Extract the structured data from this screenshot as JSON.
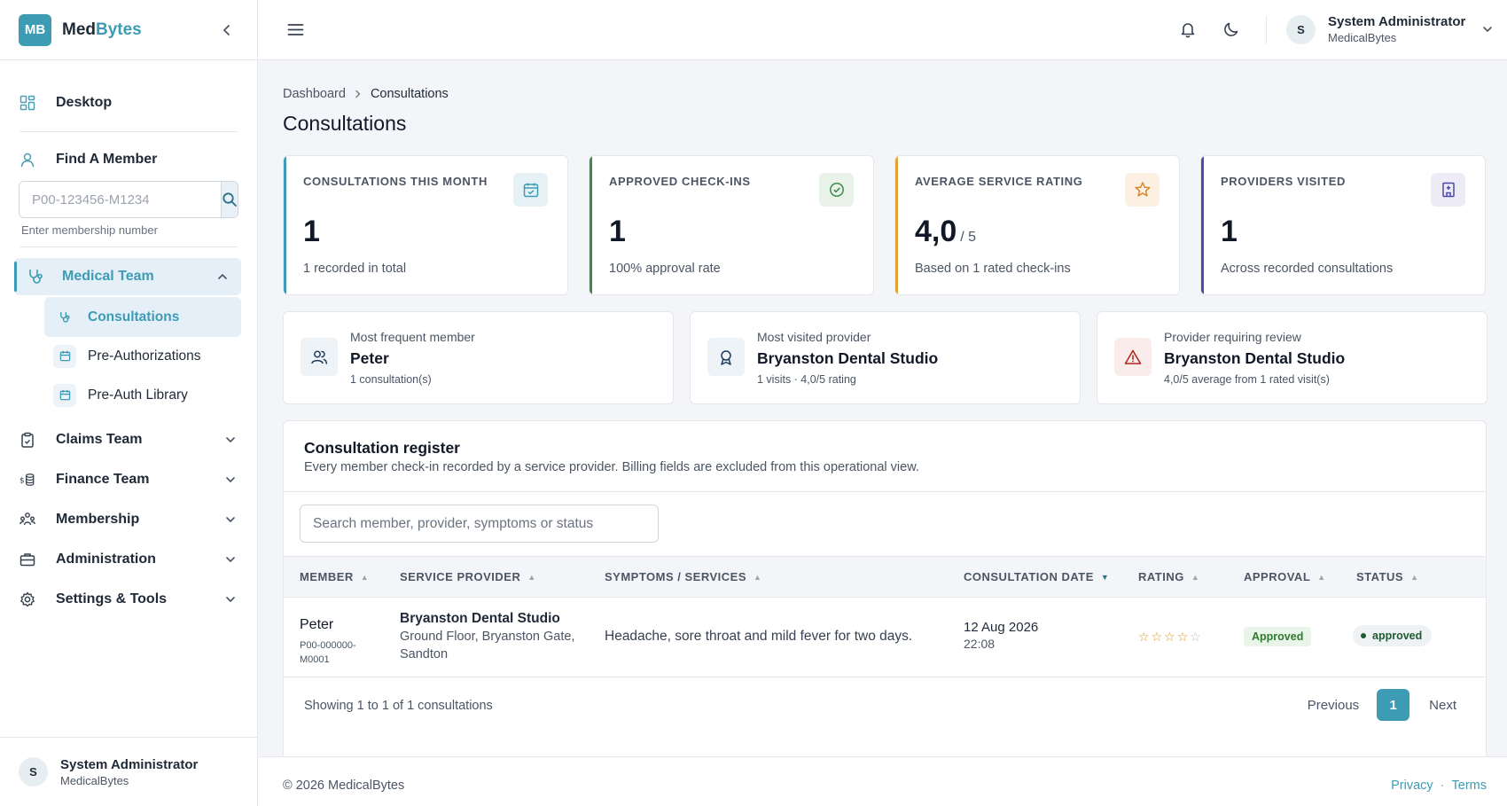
{
  "brand": {
    "badge": "MB",
    "name_a": "Med",
    "name_b": "Bytes",
    "accent_color": "#3d9bb4"
  },
  "sidebar": {
    "desktop_label": "Desktop",
    "find_member_label": "Find A Member",
    "member_search_placeholder": "P00-123456-M1234",
    "member_search_hint": "Enter membership number",
    "medical_team_label": "Medical Team",
    "medical_team_items": [
      {
        "label": "Consultations",
        "icon": "stethoscope-icon",
        "active": true
      },
      {
        "label": "Pre-Authorizations",
        "icon": "calendar-icon",
        "active": false
      },
      {
        "label": "Pre-Auth Library",
        "icon": "calendar-icon",
        "active": false
      }
    ],
    "groups": [
      {
        "label": "Claims Team",
        "icon": "clipboard-icon"
      },
      {
        "label": "Finance Team",
        "icon": "coins-icon"
      },
      {
        "label": "Membership",
        "icon": "users-icon"
      },
      {
        "label": "Administration",
        "icon": "briefcase-icon"
      },
      {
        "label": "Settings & Tools",
        "icon": "gear-icon"
      }
    ],
    "user": {
      "initial": "S",
      "name": "System Administrator",
      "org": "MedicalBytes"
    }
  },
  "topbar": {
    "user": {
      "initial": "S",
      "name": "System Administrator",
      "org": "MedicalBytes"
    }
  },
  "breadcrumb": {
    "root": "Dashboard",
    "current": "Consultations"
  },
  "page_title": "Consultations",
  "stats": [
    {
      "key": "CONSULTATIONS THIS MONTH",
      "value": "1",
      "suffix": "",
      "desc": "1 recorded in total",
      "color": "#3d9bb4",
      "icon": "calendar-check-icon"
    },
    {
      "key": "APPROVED CHECK-INS",
      "value": "1",
      "suffix": "",
      "desc": "100% approval rate",
      "color": "#3f8a4b",
      "icon": "check-circle-icon"
    },
    {
      "key": "AVERAGE SERVICE RATING",
      "value": "4,0",
      "suffix": "/ 5",
      "desc": "Based on 1 rated check-ins",
      "color": "#e0a33a",
      "icon": "star-icon"
    },
    {
      "key": "PROVIDERS VISITED",
      "value": "1",
      "suffix": "",
      "desc": "Across recorded consultations",
      "color": "#4b4aa6",
      "icon": "hospital-icon"
    }
  ],
  "insights": [
    {
      "title": "Most frequent member",
      "headline": "Peter",
      "sub": "1 consultation(s)",
      "icon": "users-icon"
    },
    {
      "title": "Most visited provider",
      "headline": "Bryanston Dental Studio",
      "sub": "1 visits · 4,0/5 rating",
      "icon": "award-icon"
    },
    {
      "title": "Provider requiring review",
      "headline": "Bryanston Dental Studio",
      "sub": "4,0/5 average from 1 rated visit(s)",
      "icon": "warning-icon"
    }
  ],
  "register": {
    "title": "Consultation register",
    "description": "Every member check-in recorded by a service provider. Billing fields are excluded from this operational view.",
    "search_placeholder": "Search member, provider, symptoms or status",
    "columns": [
      "MEMBER",
      "SERVICE PROVIDER",
      "SYMPTOMS / SERVICES",
      "CONSULTATION DATE",
      "RATING",
      "APPROVAL",
      "STATUS"
    ],
    "rows": [
      {
        "member": "Peter",
        "member_id": "P00-000000-M0001",
        "provider": "Bryanston Dental Studio",
        "provider_address": "Ground Floor, Bryanston Gate, Sandton",
        "symptoms": "Headache, sore throat and mild fever for two days.",
        "date": "12 Aug 2026",
        "time": "22:08",
        "rating": 4,
        "rating_max": 5,
        "approval": "Approved",
        "status": "approved"
      }
    ],
    "summary": "Showing 1 to 1 of 1 consultations",
    "pager": {
      "prev": "Previous",
      "page": "1",
      "next": "Next"
    }
  },
  "footer": {
    "copyright": "© 2026 MedicalBytes",
    "privacy": "Privacy",
    "dot": "·",
    "terms": "Terms"
  }
}
